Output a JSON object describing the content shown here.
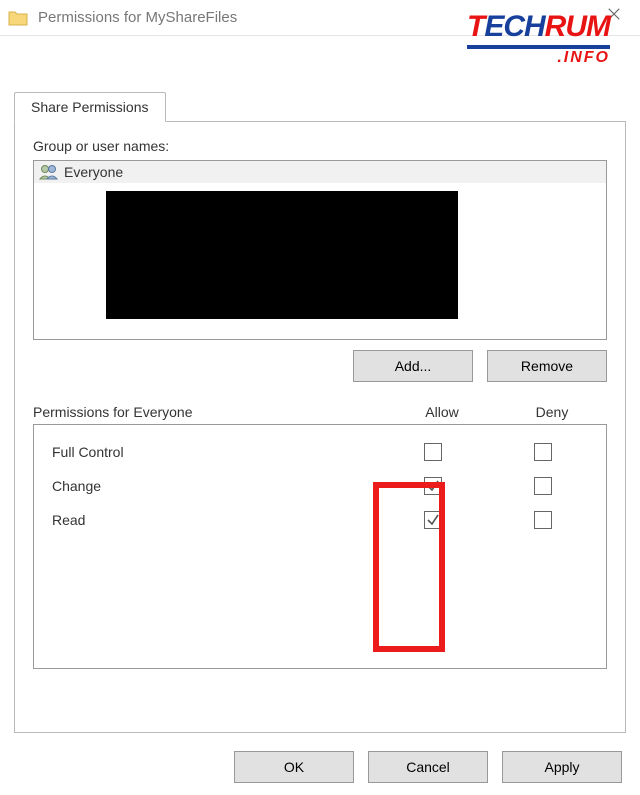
{
  "window": {
    "title": "Permissions for MyShareFiles"
  },
  "logo": {
    "part1": "T",
    "part2": "ECH",
    "part3": "RUM",
    "sub": ".INFO"
  },
  "tab_label": "Share Permissions",
  "groups_label": "Group or user names:",
  "group_items": [
    {
      "name": "Everyone"
    }
  ],
  "buttons": {
    "add": "Add...",
    "remove": "Remove",
    "ok": "OK",
    "cancel": "Cancel",
    "apply": "Apply"
  },
  "perm_label": "Permissions for Everyone",
  "cols": {
    "allow": "Allow",
    "deny": "Deny"
  },
  "perms": [
    {
      "name": "Full Control",
      "allow": false,
      "deny": false
    },
    {
      "name": "Change",
      "allow": true,
      "deny": false
    },
    {
      "name": "Read",
      "allow": true,
      "deny": false
    }
  ]
}
